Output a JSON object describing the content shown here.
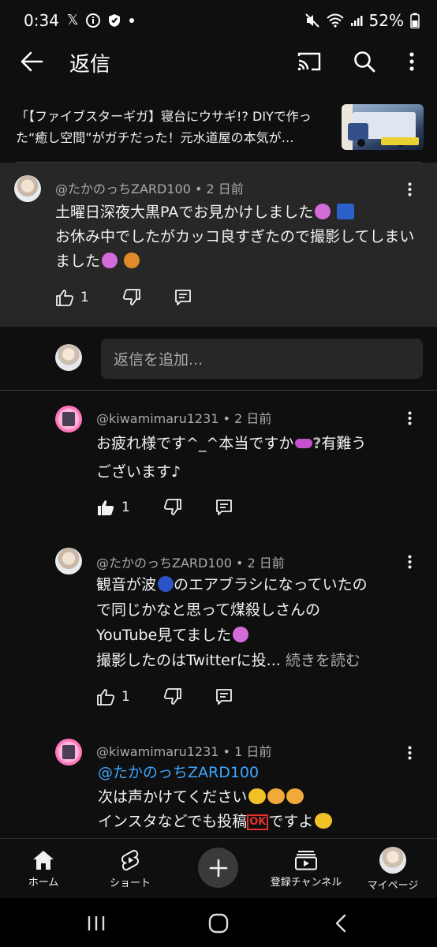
{
  "status_bar": {
    "time": "0:34",
    "battery": "52%"
  },
  "header": {
    "title": "返信"
  },
  "video": {
    "title": "「【ファイブスターギガ】寝台にウサギ!? DIYで作った“癒し空間”がガチだった！元水道屋の本気が…"
  },
  "parent_comment": {
    "author": "@たかのっちZARD100",
    "age": "2 日前",
    "line1": "土曜日深夜大黒PAでお見かけしました",
    "line2": "お休み中でしたがカッコ良すぎたので撮影してしまいました",
    "likes": "1"
  },
  "reply_box": {
    "placeholder": "返信を追加..."
  },
  "replies": [
    {
      "author": "@kiwamimaru1231",
      "age": "2 日前",
      "line1": "お疲れ様です^_^本当ですか",
      "line1b": "有難う",
      "line2": "ございます♪",
      "likes": "1"
    },
    {
      "author": "@たかのっちZARD100",
      "age": "2 日前",
      "line1a": "観音が波",
      "line1b": "のエアブラシになっていたの",
      "line2": "で同じかなと思って煤殺しさんの",
      "line3": "YouTube見てました",
      "line4": "撮影したのはTwitterに投...",
      "read_more": "続きを読む",
      "likes": "1"
    },
    {
      "author": "@kiwamimaru1231",
      "age": "1 日前",
      "mention": "@たかのっちZARD100",
      "line2": "次は声かけてください",
      "line3a": "インスタなどでも投稿",
      "line3_ok": "OK",
      "line3b": "ですよ"
    }
  ],
  "bottom_nav": {
    "home": "ホーム",
    "shorts": "ショート",
    "subscriptions": "登録チャンネル",
    "you": "マイページ"
  },
  "colors": {
    "background": "#0f0f0f",
    "surface": "#272727",
    "text": "#f1f1f1",
    "secondary_text": "#aaaaaa",
    "link": "#3ea6ff"
  }
}
